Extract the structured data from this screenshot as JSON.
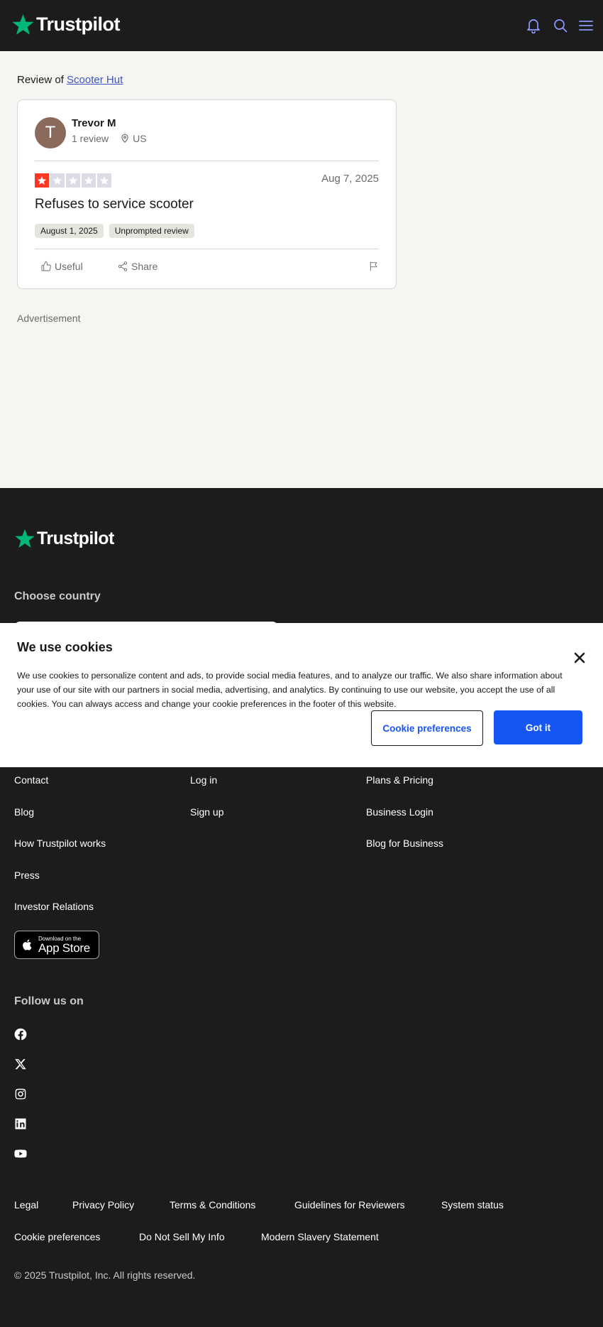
{
  "header": {
    "logo_text": "Trustpilot",
    "icons": [
      "bell-icon",
      "search-icon",
      "menu-icon"
    ],
    "colors": {
      "background": "#1c1c1c",
      "accent": "#00b67a",
      "icon": "#8c9bff"
    }
  },
  "review_page": {
    "review_of_prefix": "Review of",
    "company_name": "Scooter Hut",
    "reviewer": {
      "initial": "T",
      "name": "Trevor M",
      "review_count": "1 review",
      "country": "US"
    },
    "rating": 1,
    "rating_max": 5,
    "date": "Aug 7, 2025",
    "title": "Refuses to service scooter",
    "tags": [
      "August 1, 2025",
      "Unprompted review"
    ],
    "actions": {
      "useful": "Useful",
      "share": "Share"
    },
    "advertisement_label": "Advertisement",
    "colors": {
      "star_filled": "#ff3722",
      "star_empty": "#dcdce6",
      "link": "#3c57bc"
    }
  },
  "footer": {
    "logo_text": "Trustpilot",
    "choose_country": "Choose country",
    "links_col1": [
      "Contact",
      "Blog",
      "How Trustpilot works",
      "Press",
      "Investor Relations"
    ],
    "links_col2": [
      "Log in",
      "Sign up"
    ],
    "links_col3": [
      "Plans & Pricing",
      "Business Login",
      "Blog for Business"
    ],
    "app_store": {
      "small": "Download on the",
      "big": "App Store"
    },
    "follow_us": "Follow us on",
    "social_icons": [
      "facebook-icon",
      "x-icon",
      "instagram-icon",
      "linkedin-icon",
      "youtube-icon"
    ],
    "legal_row1": [
      "Legal",
      "Privacy Policy",
      "Terms & Conditions",
      "Guidelines for Reviewers",
      "System status"
    ],
    "legal_row2": [
      "Cookie preferences",
      "Do Not Sell My Info",
      "Modern Slavery Statement"
    ],
    "copyright": "© 2025 Trustpilot, Inc. All rights reserved."
  },
  "cookie_banner": {
    "title": "We use cookies",
    "text": "We use cookies to personalize content and ads, to provide social media features, and to analyze our traffic. We also share information about your use of our site with our partners in social media, advertising, and analytics. By continuing to use our website, you accept the use of all cookies. You can always access and change your cookie preferences in the footer of this website.",
    "preferences_button": "Cookie preferences",
    "accept_button": "Got it",
    "colors": {
      "primary": "#1755f4"
    }
  }
}
